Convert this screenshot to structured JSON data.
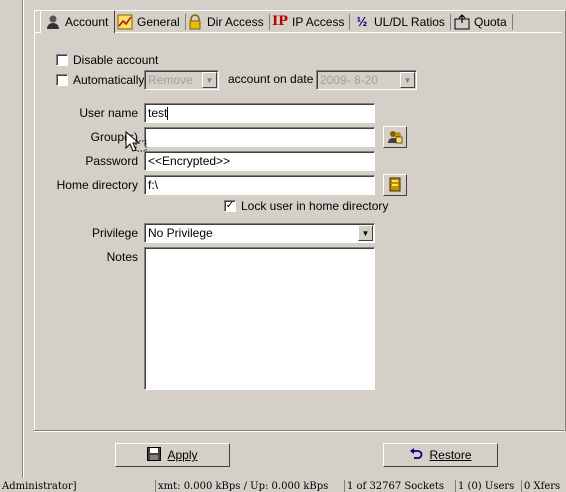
{
  "tabs": [
    {
      "label": "Account",
      "icon": "user-icon",
      "active": true
    },
    {
      "label": "General",
      "icon": "chart-icon",
      "active": false
    },
    {
      "label": "Dir Access",
      "icon": "lock-icon",
      "active": false
    },
    {
      "label": "IP Access",
      "icon": "ip-icon",
      "active": false
    },
    {
      "label": "UL/DL Ratios",
      "icon": "ratio-icon",
      "active": false
    },
    {
      "label": "Quota",
      "icon": "quota-icon",
      "active": false
    }
  ],
  "account": {
    "disable_account_label": "Disable account",
    "disable_account_checked": false,
    "automatically_label": "Automatically",
    "automatically_checked": false,
    "auto_action_value": "Remove",
    "on_date_label": "account on date",
    "date_value": "2009- 8-20",
    "username_label": "User name",
    "username_value": "test",
    "groups_label": "Group(s)",
    "groups_value": "",
    "password_label": "Password",
    "password_value": "<<Encrypted>>",
    "home_dir_label": "Home directory",
    "home_dir_value": "f:\\",
    "lock_home_label": "Lock user in home directory",
    "lock_home_checked": true,
    "privilege_label": "Privilege",
    "privilege_value": "No Privilege",
    "notes_label": "Notes",
    "notes_value": ""
  },
  "buttons": {
    "apply_label": "Apply",
    "restore_label": "Restore"
  },
  "status_bar": {
    "cell1": "Administrator]",
    "cell2": "xmt: 0.000 kBps / Up: 0.000 kBps",
    "cell3": "1 of 32767 Sockets",
    "cell4": "1 (0) Users",
    "cell5": "0 Xfers"
  }
}
